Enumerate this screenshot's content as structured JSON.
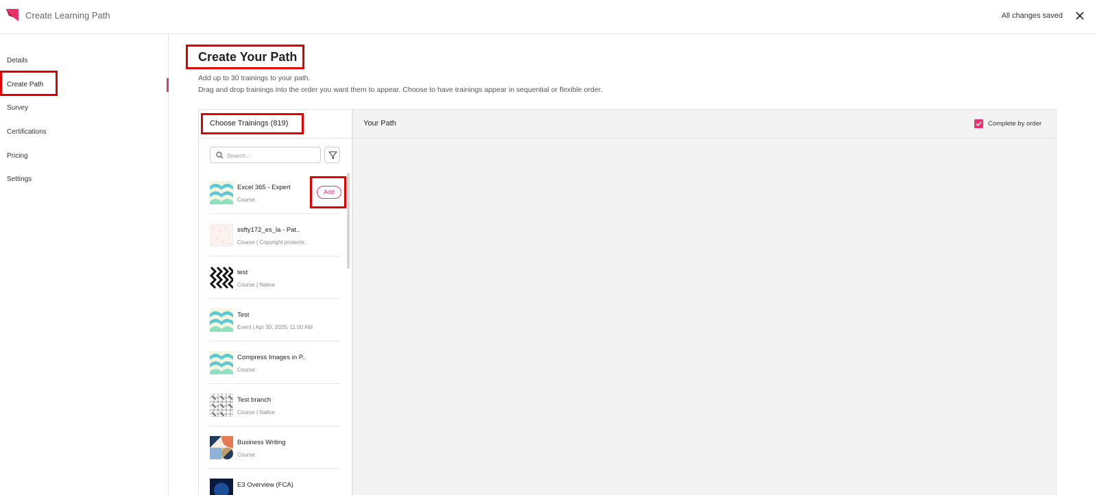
{
  "header": {
    "title": "Create Learning Path",
    "status": "All changes saved"
  },
  "sidebar": {
    "items": [
      {
        "label": "Details"
      },
      {
        "label": "Create Path"
      },
      {
        "label": "Survey"
      },
      {
        "label": "Certifications"
      },
      {
        "label": "Pricing"
      },
      {
        "label": "Settings"
      }
    ],
    "active": "Create Path"
  },
  "main": {
    "title": "Create Your Path",
    "description_line1": "Add up to 30 trainings to your path.",
    "description_line2": "Drag and drop trainings into the order you want them to appear. Choose to have trainings appear in sequential or flexible order."
  },
  "trainings_panel": {
    "title": "Choose Trainings (819)",
    "search_placeholder": "Search...",
    "add_label": "Add",
    "items": [
      {
        "name": "Excel 365 - Expert",
        "meta": "Course"
      },
      {
        "name": "ssfty172_es_la - Pat..",
        "meta": "Course | Copyright protecte.."
      },
      {
        "name": "test",
        "meta": "Course | Native"
      },
      {
        "name": "Test",
        "meta": "Event | Apr 30, 2025; 11:00 AM"
      },
      {
        "name": "Compress Images in P..",
        "meta": "Course"
      },
      {
        "name": "Test branch",
        "meta": "Course | Native"
      },
      {
        "name": "Business Writing",
        "meta": "Course"
      },
      {
        "name": "E3 Overview (FCA)",
        "meta": ""
      }
    ]
  },
  "path_panel": {
    "title": "Your Path",
    "complete_by_order_label": "Complete by order",
    "complete_by_order_checked": true
  },
  "colors": {
    "accent": "#e8336a",
    "highlight": "#e00000",
    "panel_bg": "#f3f3f3"
  }
}
